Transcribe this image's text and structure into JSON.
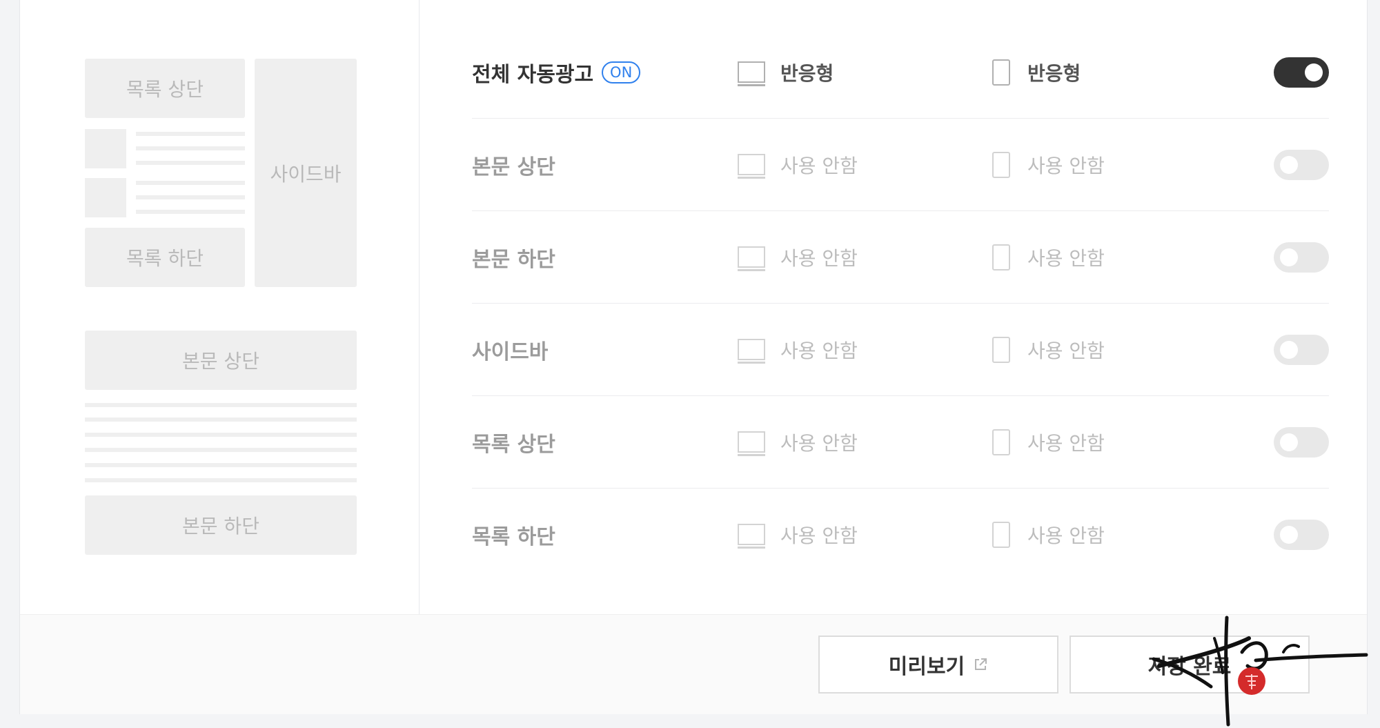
{
  "layout_preview": {
    "list_top": "목록 상단",
    "list_bottom": "목록 하단",
    "sidebar": "사이드바",
    "body_top": "본문 상단",
    "body_bottom": "본문 하단"
  },
  "rows": [
    {
      "label": "전체 자동광고",
      "badge": "ON",
      "desktop": "반응형",
      "mobile": "반응형",
      "enabled": true
    },
    {
      "label": "본문 상단",
      "desktop": "사용 안함",
      "mobile": "사용 안함",
      "enabled": false
    },
    {
      "label": "본문 하단",
      "desktop": "사용 안함",
      "mobile": "사용 안함",
      "enabled": false
    },
    {
      "label": "사이드바",
      "desktop": "사용 안함",
      "mobile": "사용 안함",
      "enabled": false
    },
    {
      "label": "목록 상단",
      "desktop": "사용 안함",
      "mobile": "사용 안함",
      "enabled": false
    },
    {
      "label": "목록 하단",
      "desktop": "사용 안함",
      "mobile": "사용 안함",
      "enabled": false
    }
  ],
  "footer": {
    "preview_label": "미리보기",
    "save_label": "저장 완료"
  },
  "icons": {
    "desktop": "monitor-icon",
    "mobile": "phone-icon",
    "external": "external-link-icon"
  },
  "colors": {
    "accent": "#2f80ed",
    "toggle_on": "#333333",
    "toggle_off": "#e8e8e8"
  }
}
